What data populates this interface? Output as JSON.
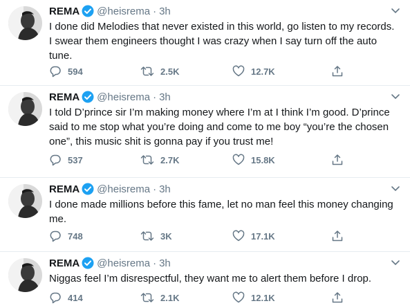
{
  "tweets": [
    {
      "name": "REMA",
      "handle": "@heisrema",
      "separator": "·",
      "time": "3h",
      "text": "I done did Melodies that never existed in this world, go listen to my records. I swear them engineers thought I was crazy when I say turn off the auto tune.",
      "replies": "594",
      "retweets": "2.5K",
      "likes": "12.7K"
    },
    {
      "name": "REMA",
      "handle": "@heisrema",
      "separator": "·",
      "time": "3h",
      "text": "I told D’prince sir I’m making money where I’m at I think I’m good. D’prince said to me stop what you’re doing and come to me boy “you’re the chosen one”, this music shit is gonna pay if you trust me!",
      "replies": "537",
      "retweets": "2.7K",
      "likes": "15.8K"
    },
    {
      "name": "REMA",
      "handle": "@heisrema",
      "separator": "·",
      "time": "3h",
      "text": "I done made millions before this fame, let no man feel this money changing me.",
      "replies": "748",
      "retweets": "3K",
      "likes": "17.1K"
    },
    {
      "name": "REMA",
      "handle": "@heisrema",
      "separator": "·",
      "time": "3h",
      "text": "Niggas feel I’m disrespectful, they want me to alert them before I drop.",
      "replies": "414",
      "retweets": "2.1K",
      "likes": "12.1K"
    }
  ],
  "icons": {
    "verified": "verified-badge-icon",
    "caret": "chevron-down-icon",
    "reply": "reply-icon",
    "retweet": "retweet-icon",
    "like": "heart-icon",
    "share": "share-icon"
  },
  "colors": {
    "accent": "#1da1f2",
    "secondary_text": "#657786",
    "divider": "#e6ecf0"
  }
}
